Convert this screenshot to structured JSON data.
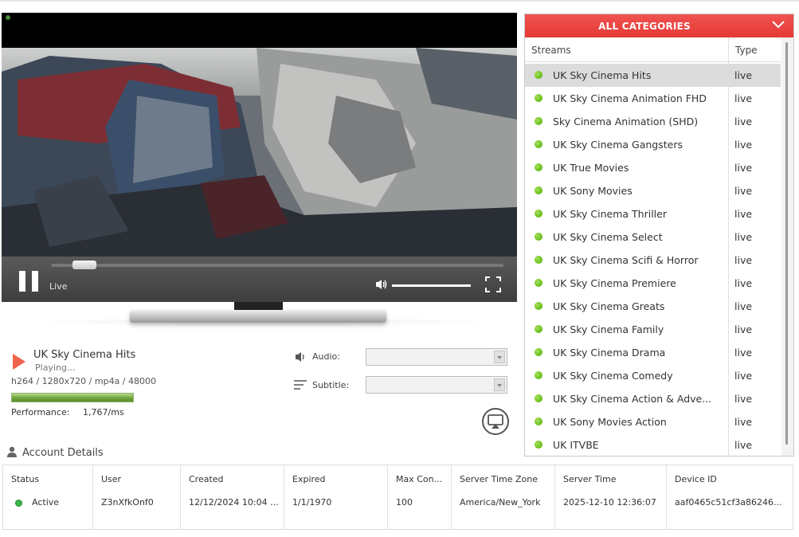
{
  "player": {
    "live_label": "Live",
    "seek_progress": 0.05,
    "volume_level": 1.0
  },
  "now_playing": {
    "title": "UK Sky Cinema Hits",
    "status": "Playing...",
    "codec_info": "h264 / 1280x720 / mp4a / 48000",
    "performance_label": "Performance:",
    "performance_value": "1,767/ms"
  },
  "options": {
    "audio_label": "Audio:",
    "subtitle_label": "Subtitle:"
  },
  "categories": {
    "header": "ALL CATEGORIES",
    "col_streams": "Streams",
    "col_type": "Type",
    "items": [
      {
        "name": "UK Sky Cinema Hits",
        "type": "live",
        "selected": true
      },
      {
        "name": "UK Sky Cinema Animation FHD",
        "type": "live"
      },
      {
        "name": "Sky Cinema Animation (SHD)",
        "type": "live"
      },
      {
        "name": "UK Sky Cinema Gangsters",
        "type": "live"
      },
      {
        "name": "UK True Movies",
        "type": "live"
      },
      {
        "name": "UK Sony Movies",
        "type": "live"
      },
      {
        "name": "UK Sky Cinema Thriller",
        "type": "live"
      },
      {
        "name": "UK Sky Cinema Select",
        "type": "live"
      },
      {
        "name": "UK Sky Cinema Scifi & Horror",
        "type": "live"
      },
      {
        "name": "UK Sky Cinema Premiere",
        "type": "live"
      },
      {
        "name": "UK Sky Cinema Greats",
        "type": "live"
      },
      {
        "name": "UK Sky Cinema Family",
        "type": "live"
      },
      {
        "name": "UK Sky Cinema Drama",
        "type": "live"
      },
      {
        "name": "UK Sky Cinema Comedy",
        "type": "live"
      },
      {
        "name": "UK Sky Cinema Action & Adve...",
        "type": "live"
      },
      {
        "name": "UK Sony Movies Action",
        "type": "live"
      },
      {
        "name": "UK ITVBE",
        "type": "live"
      }
    ]
  },
  "account": {
    "heading": "Account Details",
    "columns": [
      {
        "header": "Status",
        "value": "Active"
      },
      {
        "header": "User",
        "value": "Z3nXfkOnf0"
      },
      {
        "header": "Created",
        "value": "12/12/2024 10:04 ..."
      },
      {
        "header": "Expired",
        "value": "1/1/1970"
      },
      {
        "header": "Max Con...",
        "value": "100"
      },
      {
        "header": "Server Time Zone",
        "value": "America/New_York"
      },
      {
        "header": "Server Time",
        "value": "2025-12-10 12:36:07"
      },
      {
        "header": "Device ID",
        "value": "aaf0465c51cf3a86246..."
      }
    ]
  },
  "colors": {
    "accent_red": "#e53935",
    "live_green": "#6cc21f",
    "active_green": "#3ab54a"
  }
}
